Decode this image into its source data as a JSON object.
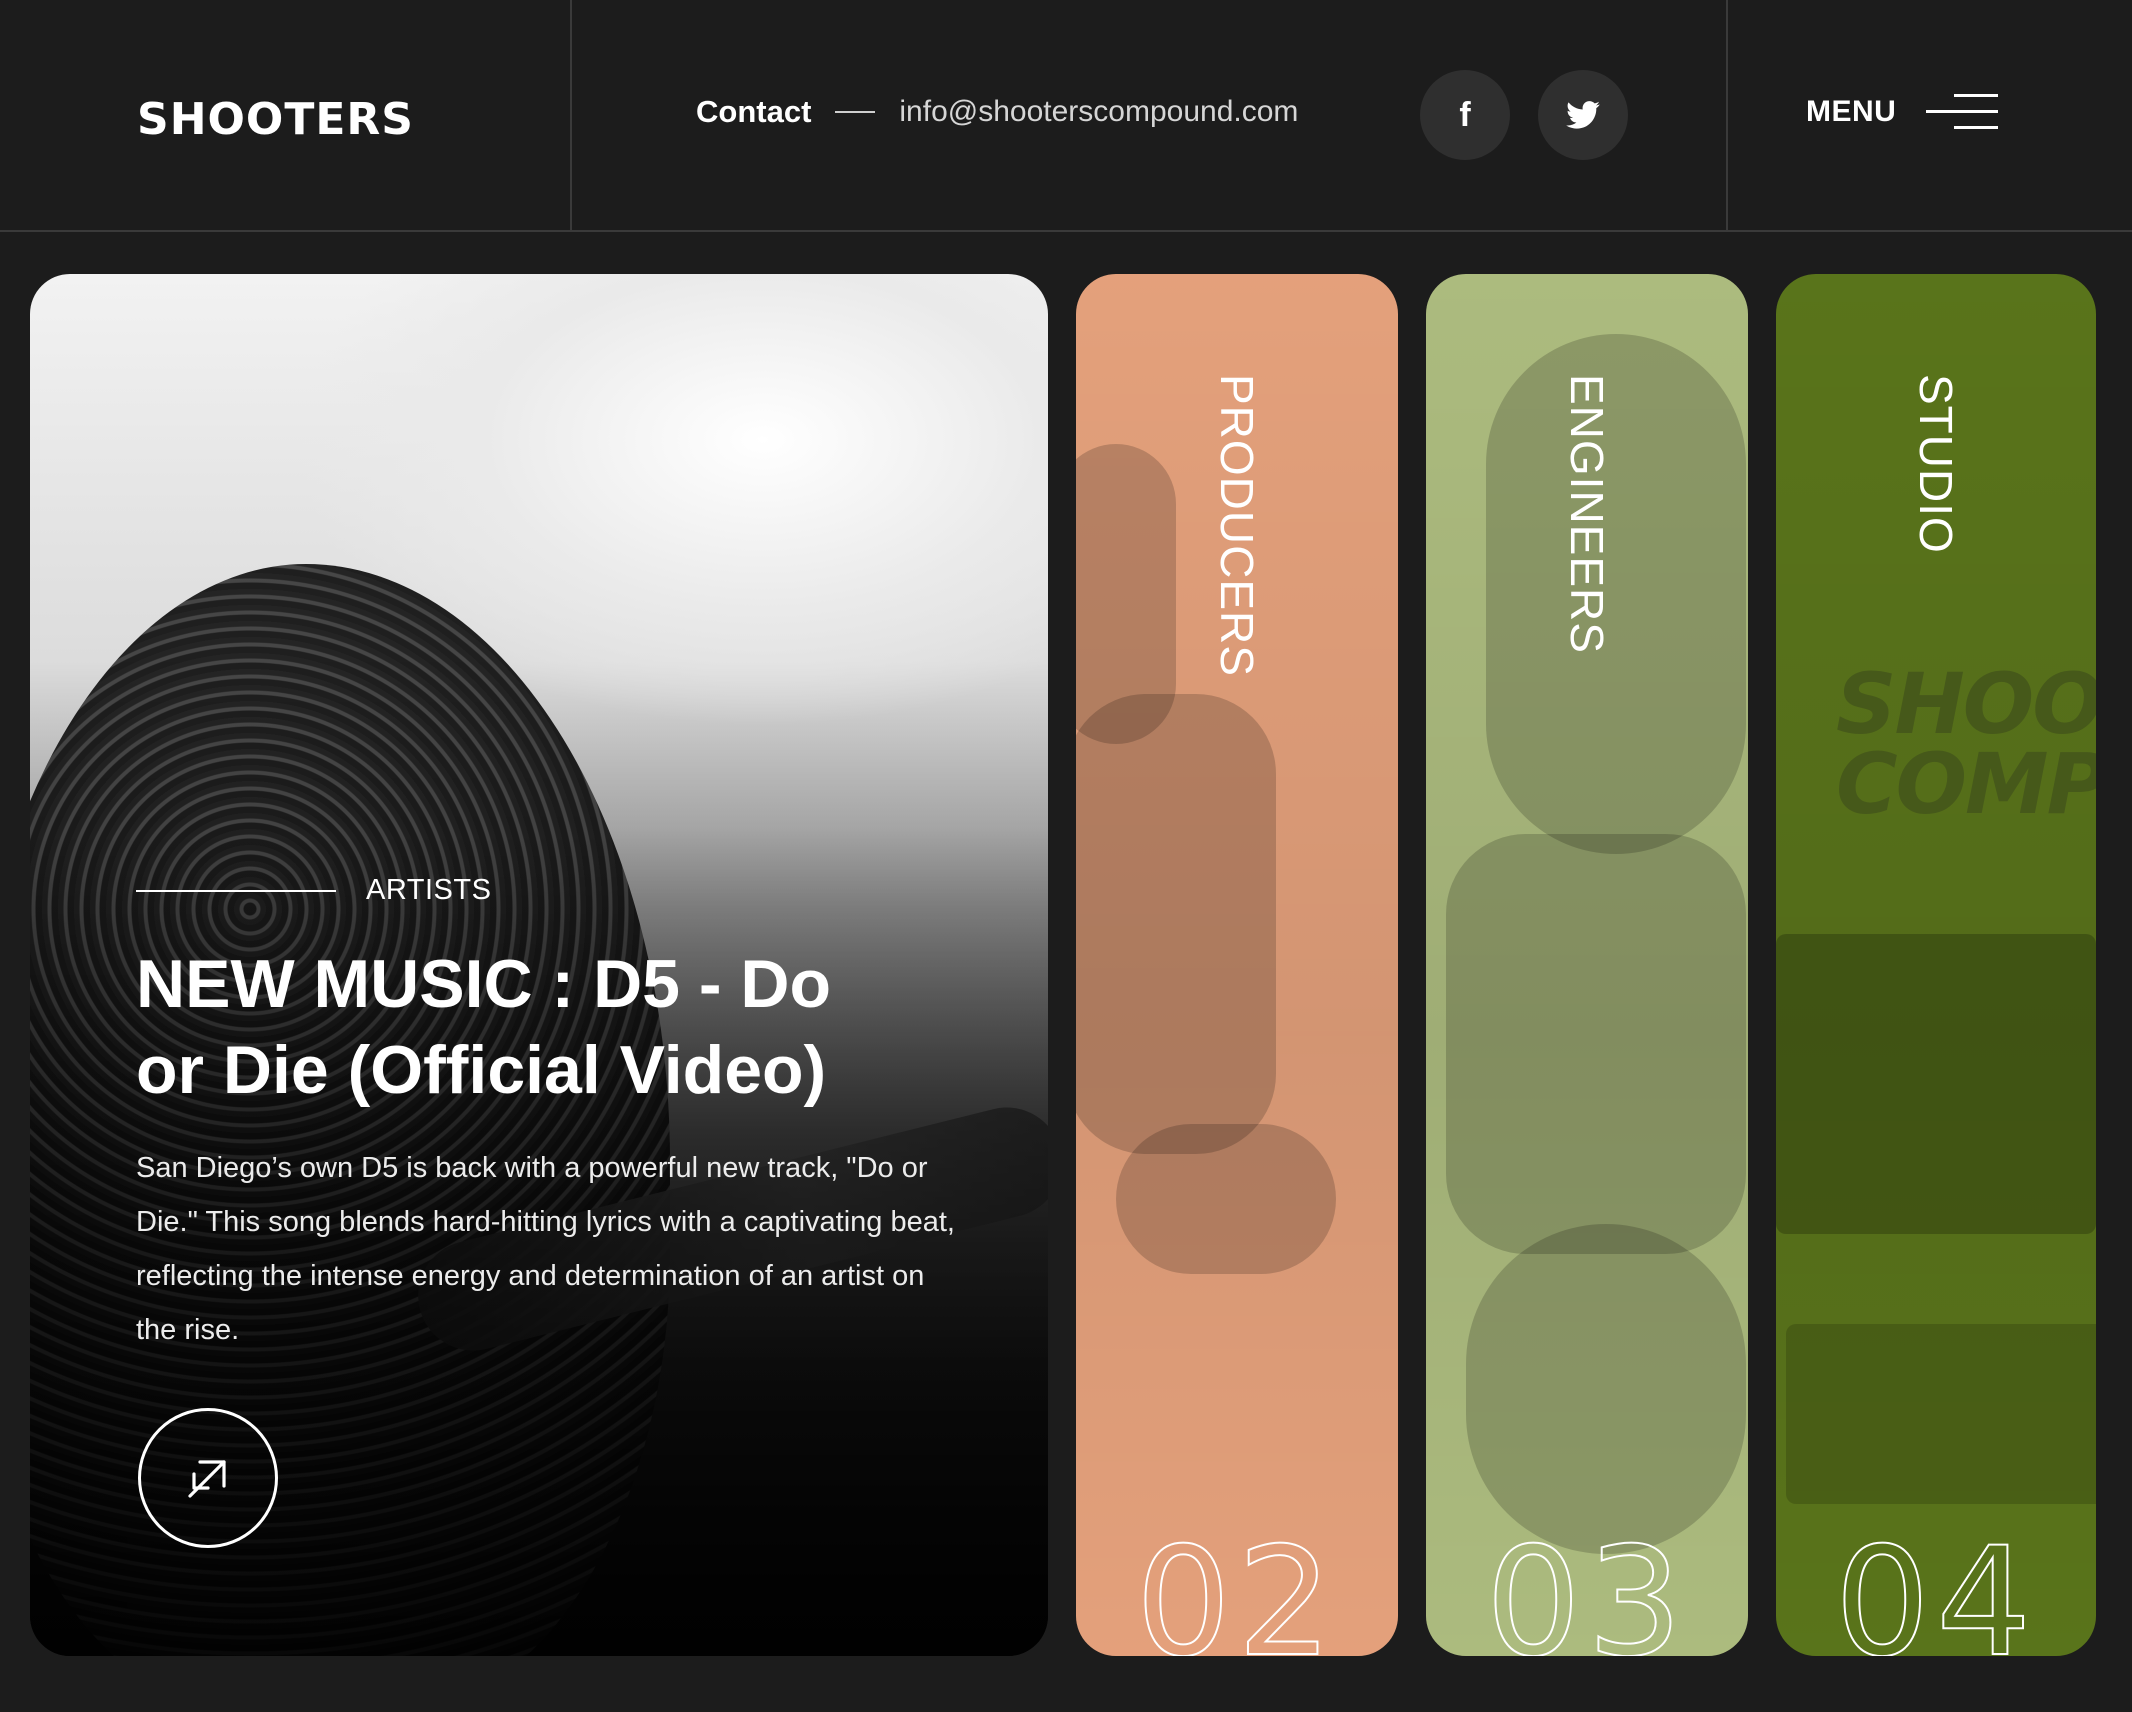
{
  "header": {
    "logo": "SHOOTERS",
    "contact_label": "Contact",
    "contact_email": "info@shooterscompound.com",
    "social": [
      {
        "name": "facebook-icon",
        "glyph": "f"
      },
      {
        "name": "twitter-icon"
      }
    ],
    "menu_label": "MENU"
  },
  "feature": {
    "category": "ARTISTS",
    "title": "NEW MUSIC : D5 - Do or Die (Official Video)",
    "description": "San Diego’s own D5 is back with a powerful new track, \"Do or Die.\" This song blends hard-hitting lyrics with a captivating beat, reflecting the intense energy and determination of an artist on the rise."
  },
  "categories": [
    {
      "label": "PRODUCERS",
      "number": "02",
      "color": "#f0a982"
    },
    {
      "label": "ENGINEERS",
      "number": "03",
      "color": "#b5c585"
    },
    {
      "label": "STUDIO",
      "number": "04",
      "color": "#5e7a1c"
    }
  ],
  "studio_sign": "SHOOT COMPO"
}
